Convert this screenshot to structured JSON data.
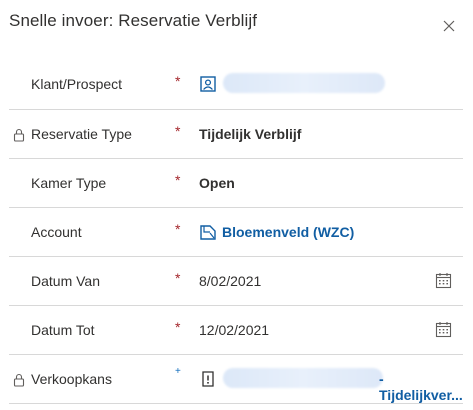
{
  "dialog": {
    "title": "Snelle invoer: Reservatie Verblijf",
    "close_icon": "close-icon"
  },
  "fields": [
    {
      "label": "Klant/Prospect",
      "required": "*",
      "value": "",
      "icon": "contact-icon",
      "locked": false
    },
    {
      "label": "Reservatie Type",
      "required": "*",
      "value": "Tijdelijk Verblijf",
      "locked": true
    },
    {
      "label": "Kamer Type",
      "required": "*",
      "value": "Open",
      "locked": false
    },
    {
      "label": "Account",
      "required": "*",
      "value": "Bloemenveld (WZC)",
      "icon": "account-icon",
      "locked": false
    },
    {
      "label": "Datum Van",
      "required": "*",
      "value": "8/02/2021",
      "icon": "calendar-icon",
      "locked": false
    },
    {
      "label": "Datum Tot",
      "required": "*",
      "value": "12/02/2021",
      "icon": "calendar-icon",
      "locked": false
    },
    {
      "label": "Verkoopkans",
      "required": "+",
      "value": "- Tijdelijkver...",
      "icon": "opportunity-icon",
      "locked": true
    }
  ],
  "colors": {
    "required": "#a4262c",
    "recommended": "#0f6cbd",
    "link": "#115ea3",
    "divider": "#d8d8d8"
  }
}
